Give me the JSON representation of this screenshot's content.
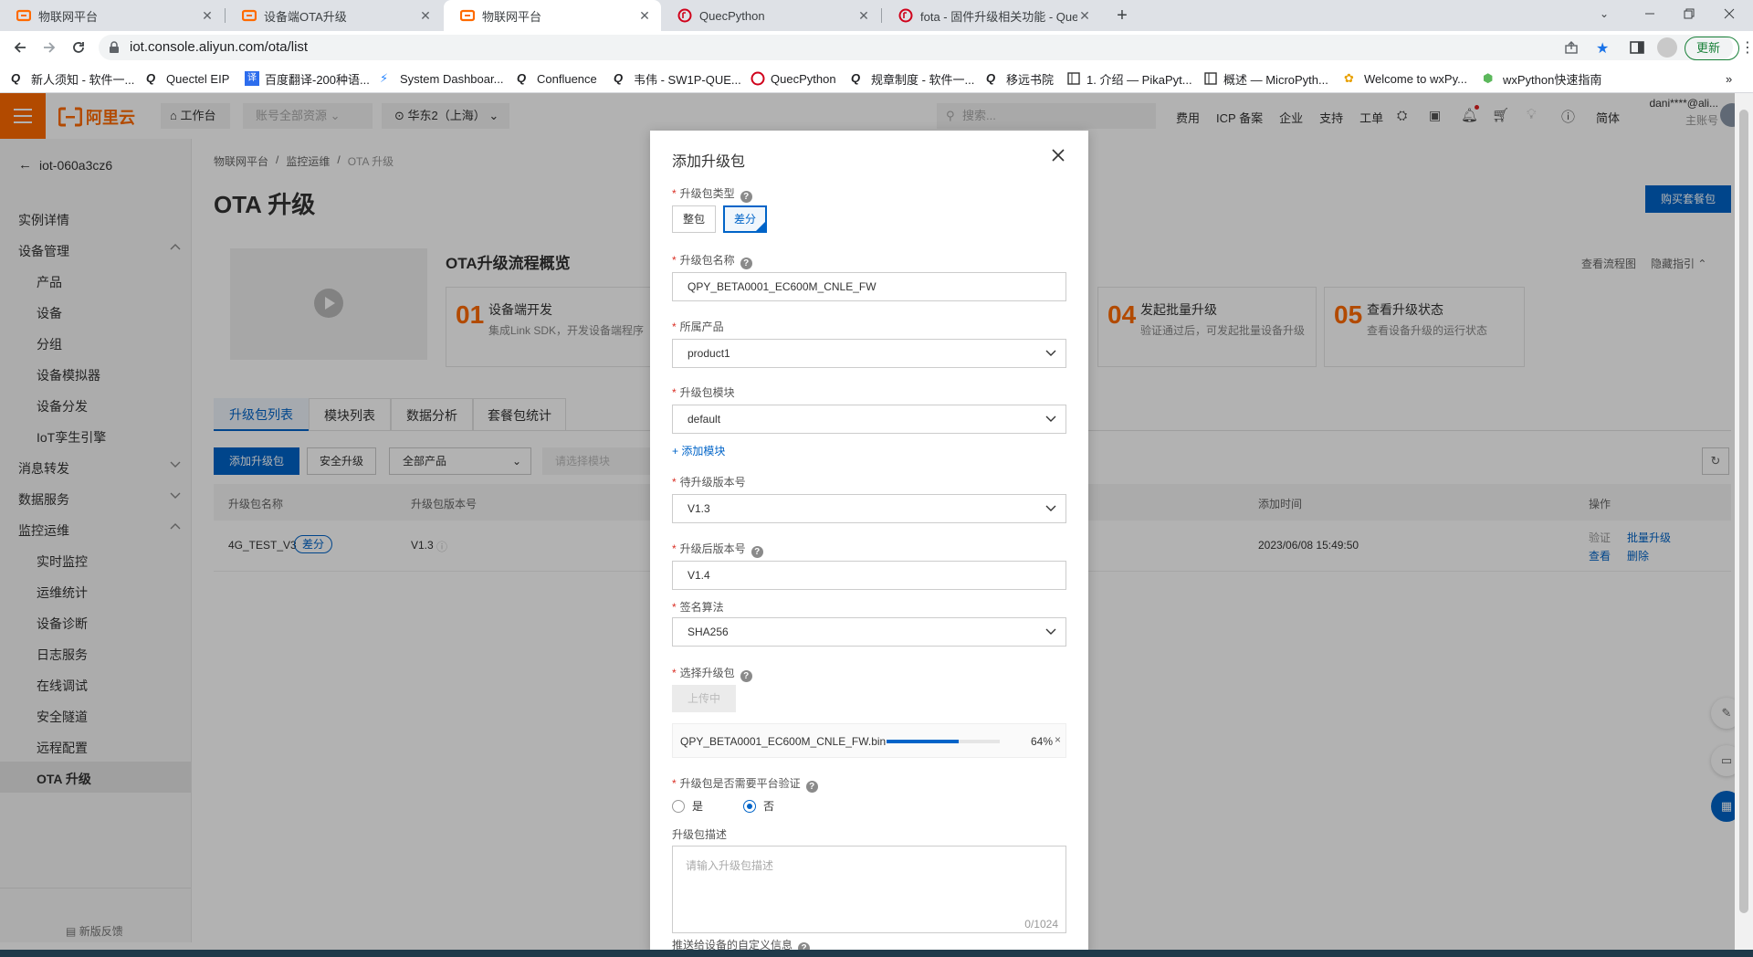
{
  "browser": {
    "tabs": [
      {
        "title": "物联网平台",
        "icon": "aliyun-icon",
        "active": false
      },
      {
        "title": "设备端OTA升级",
        "icon": "aliyun-icon",
        "active": false
      },
      {
        "title": "物联网平台",
        "icon": "aliyun-icon",
        "active": true
      },
      {
        "title": "QuecPython",
        "icon": "quectel-icon",
        "active": false
      },
      {
        "title": "fota - 固件升级相关功能 - Quec",
        "icon": "quectel-icon",
        "active": false
      }
    ],
    "url": "iot.console.aliyun.com/ota/list",
    "update_label": "更新",
    "bookmarks": [
      "新人须知 - 软件一...",
      "Quectel EIP",
      "百度翻译-200种语...",
      "System Dashboar...",
      "Confluence",
      "韦伟 - SW1P-QUE...",
      "QuecPython",
      "规章制度 - 软件一...",
      "移远书院",
      "1. 介绍 — PikaPyt...",
      "概述 — MicroPyth...",
      "Welcome to wxPy...",
      "wxPython快速指南"
    ]
  },
  "console_header": {
    "logo": "阿里云",
    "workbench": "工作台",
    "account": "账号全部资源",
    "region": "华东2（上海）",
    "search_placeholder": "搜索...",
    "nav": [
      "费用",
      "ICP 备案",
      "企业",
      "支持",
      "工单"
    ],
    "lang": "简体",
    "user": "dani****@ali...",
    "user_role": "主账号"
  },
  "sidebar": {
    "instance": "iot-060a3cz6",
    "items": [
      {
        "label": "实例详情",
        "level": 1
      },
      {
        "label": "设备管理",
        "level": 1,
        "expanded": true
      },
      {
        "label": "产品",
        "level": 2
      },
      {
        "label": "设备",
        "level": 2
      },
      {
        "label": "分组",
        "level": 2
      },
      {
        "label": "设备模拟器",
        "level": 2
      },
      {
        "label": "设备分发",
        "level": 2
      },
      {
        "label": "IoT孪生引擎",
        "level": 2
      },
      {
        "label": "消息转发",
        "level": 1,
        "expanded": false
      },
      {
        "label": "数据服务",
        "level": 1,
        "expanded": false
      },
      {
        "label": "监控运维",
        "level": 1,
        "expanded": true
      },
      {
        "label": "实时监控",
        "level": 2
      },
      {
        "label": "运维统计",
        "level": 2
      },
      {
        "label": "设备诊断",
        "level": 2
      },
      {
        "label": "日志服务",
        "level": 2
      },
      {
        "label": "在线调试",
        "level": 2
      },
      {
        "label": "安全隧道",
        "level": 2
      },
      {
        "label": "远程配置",
        "level": 2
      },
      {
        "label": "OTA 升级",
        "level": 2,
        "active": true
      }
    ],
    "feedback": "新版反馈"
  },
  "main": {
    "breadcrumb": [
      "物联网平台",
      "监控运维",
      "OTA 升级"
    ],
    "title": "OTA 升级",
    "buy_button": "购买套餐包",
    "overview_title": "OTA升级流程概览",
    "view_flow": "查看流程图",
    "hide_guide": "隐藏指引",
    "steps": [
      {
        "num": "01",
        "title": "设备端开发",
        "desc": "集成Link SDK，开发设备端程序"
      },
      {
        "num": "04",
        "title": "发起批量升级",
        "desc": "验证通过后，可发起批量设备升级"
      },
      {
        "num": "05",
        "title": "查看升级状态",
        "desc": "查看设备升级的运行状态"
      }
    ],
    "tabs": [
      "升级包列表",
      "模块列表",
      "数据分析",
      "套餐包统计"
    ],
    "toolbar": {
      "add": "添加升级包",
      "secure": "安全升级",
      "product_filter": "全部产品",
      "module_filter": "请选择模块"
    },
    "table": {
      "headers": [
        "升级包名称",
        "升级包版本号",
        "添加时间",
        "操作"
      ],
      "rows": [
        {
          "name": "4G_TEST_V3",
          "tag": "差分",
          "version": "V1.3",
          "time": "2023/06/08 15:49:50",
          "actions": [
            "验证",
            "批量升级",
            "查看",
            "删除"
          ]
        }
      ]
    }
  },
  "modal": {
    "title": "添加升级包",
    "pkg_type_label": "升级包类型",
    "pkg_types": [
      "整包",
      "差分"
    ],
    "pkg_type_selected": "差分",
    "name_label": "升级包名称",
    "name_value": "QPY_BETA0001_EC600M_CNLE_FW",
    "product_label": "所属产品",
    "product_value": "product1",
    "module_label": "升级包模块",
    "module_value": "default",
    "add_module": "+ 添加模块",
    "src_version_label": "待升级版本号",
    "src_version_value": "V1.3",
    "dst_version_label": "升级后版本号",
    "dst_version_value": "V1.4",
    "sign_label": "签名算法",
    "sign_value": "SHA256",
    "select_pkg_label": "选择升级包",
    "uploading_button": "上传中",
    "file_name": "QPY_BETA0001_EC600M_CNLE_FW.bin",
    "progress": 0.64,
    "progress_text": "64%",
    "verify_label": "升级包是否需要平台验证",
    "verify_options": [
      "是",
      "否"
    ],
    "verify_selected": "否",
    "desc_label": "升级包描述",
    "desc_placeholder": "请输入升级包描述",
    "desc_counter": "0/1024",
    "custom_label": "推送给设备的自定义信息"
  },
  "colors": {
    "aliyun_orange": "#ff6a00",
    "primary": "#0064c8",
    "sidebar_active": "#e6e6e6"
  }
}
